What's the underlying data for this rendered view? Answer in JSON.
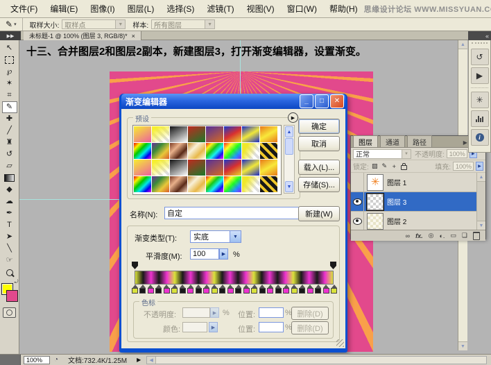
{
  "menu": {
    "items": [
      "文件(F)",
      "编辑(E)",
      "图像(I)",
      "图层(L)",
      "选择(S)",
      "滤镜(T)",
      "视图(V)",
      "窗口(W)",
      "帮助(H)"
    ],
    "brand": "思缘设计论坛 WWW.MISSYUAN.COM"
  },
  "options_bar": {
    "sample_size_label": "取样大小:",
    "sample_size_value": "取样点",
    "sample_label": "样本:",
    "sample_value": "所有图层"
  },
  "doc_tab": {
    "title": "未标题-1 @ 100% (图层 3, RGB/8)*",
    "close": "×"
  },
  "instruction": "十三、合并图层2和图层2副本，新建图层3，打开渐变编辑器，设置渐变。",
  "toolbar": {
    "tools": [
      {
        "name": "move-tool",
        "glyph": "↖"
      },
      {
        "name": "marquee-tool",
        "cls": "icon-dashed"
      },
      {
        "name": "lasso-tool",
        "glyph": "℘"
      },
      {
        "name": "magic-wand-tool",
        "glyph": "✶"
      },
      {
        "name": "crop-tool",
        "glyph": "⌗"
      },
      {
        "name": "eyedropper-tool",
        "glyph": "✎",
        "selected": true
      },
      {
        "name": "healing-brush-tool",
        "glyph": "✚"
      },
      {
        "name": "brush-tool",
        "glyph": "╱"
      },
      {
        "name": "clone-stamp-tool",
        "glyph": "♜"
      },
      {
        "name": "history-brush-tool",
        "glyph": "↺"
      },
      {
        "name": "eraser-tool",
        "glyph": "▱"
      },
      {
        "name": "gradient-tool",
        "cls": "icon-grad"
      },
      {
        "name": "blur-tool",
        "glyph": "◆"
      },
      {
        "name": "dodge-tool",
        "glyph": "☁"
      },
      {
        "name": "pen-tool",
        "glyph": "✒"
      },
      {
        "name": "type-tool",
        "glyph": "T"
      },
      {
        "name": "path-selection-tool",
        "glyph": "➤"
      },
      {
        "name": "line-tool",
        "glyph": "╲"
      },
      {
        "name": "hand-tool",
        "glyph": "☞"
      },
      {
        "name": "zoom-tool",
        "cls": "icon-zoom"
      }
    ],
    "foreground_color": "#ffff00",
    "background_color": "#e2498c"
  },
  "canvas_colors": {
    "background": "#e2498c",
    "rays": "#f9a04a",
    "guide": "#a8e4de"
  },
  "dialog": {
    "title": "渐变编辑器",
    "presets_label": "预设",
    "ok": "确定",
    "cancel": "取消",
    "load": "载入(L)...",
    "save": "存储(S)...",
    "name_label": "名称(N):",
    "name_value": "自定",
    "new_button": "新建(W)",
    "type_label": "渐变类型(T):",
    "type_value": "实底",
    "smooth_label": "平滑度(M):",
    "smooth_value": "100",
    "percent": "%",
    "stops_label": "色标",
    "opacity_label": "不透明度:",
    "color_label": "颜色:",
    "location_label": "位置:",
    "location2_label": "位置:",
    "delete_label": "删除(D)",
    "presets": [
      "linear-gradient(150deg,#f6ef2f,#ec5f9f)",
      "linear-gradient(150deg,#f6ef2f 15%,rgba(246,239,47,0) 85%),repeating-linear-gradient(45deg,#ddd 0 4px,#fff 4px 8px)",
      "linear-gradient(150deg,#141414,#fdfdfd)",
      "linear-gradient(150deg,#c02a20,#1a7a2a)",
      "linear-gradient(150deg,#53309c,#d86a20)",
      "linear-gradient(150deg,#1a3ac8,#d83030,#e8d82a)",
      "linear-gradient(150deg,#1a2ac8,#f0e83a,#1a2ac8)",
      "linear-gradient(150deg,#e87a1a,#f8e83a,#e87a1a)",
      "linear-gradient(135deg,#f00000,#f8f000,#00c800,#00e8e8,#0000f0,#e800e8)",
      "linear-gradient(135deg,#6a2a9c,#3a8a3a,#e8c83a,#d85a2a)",
      "linear-gradient(135deg,#7a3a22,#e8b08a,#5a2a18,#f8d8c0)",
      "linear-gradient(135deg,#c8882a,#f8f0d8,#e8b84a,#fffbe8)",
      "linear-gradient(135deg,#f01818,#f8f018,#18c818,#18f0f0,#1818f0,#f018f0)",
      "linear-gradient(135deg,rgba(255,0,0,.85),rgba(255,255,0,.85),rgba(0,255,0,.85),rgba(0,128,255,.85),rgba(128,0,255,.85)),repeating-linear-gradient(45deg,#ddd 0 4px,#fff 4px 8px)",
      "linear-gradient(120deg,#f0e82a 25%,rgba(240,232,42,0) 75%),repeating-linear-gradient(45deg,#ddd 0 4px,#fff 4px 8px)",
      "repeating-linear-gradient(45deg,#181818 0 5px,#f0c82a 5px 9px)"
    ],
    "gradient_stops": [
      "#d9e23b",
      "#191919",
      "#ee33d0",
      "#191919",
      "#ee33d0",
      "#d9e23b",
      "#191919",
      "#ee33d0",
      "#191919",
      "#ee33d0",
      "#d9e23b",
      "#191919",
      "#ee33d0",
      "#191919",
      "#ee33d0",
      "#d9e23b",
      "#191919",
      "#ee33d0",
      "#191919",
      "#ee33d0",
      "#d9e23b",
      "#191919",
      "#ee33d0",
      "#191919",
      "#ee33d0",
      "#d9e23b"
    ]
  },
  "layers_panel": {
    "tabs": [
      "图层",
      "通道",
      "路径"
    ],
    "blend_mode": "正常",
    "opacity_label": "不透明度:",
    "opacity_value": "100%",
    "lock_label": "锁定:",
    "fill_label": "填充:",
    "fill_value": "100%",
    "layers": [
      {
        "name": "图层 1",
        "eye": false,
        "selected": false,
        "thumb": "star"
      },
      {
        "name": "图层 3",
        "eye": true,
        "selected": true,
        "thumb": "checker"
      },
      {
        "name": "图层 2",
        "eye": true,
        "selected": false,
        "thumb": "pale"
      }
    ]
  },
  "status_bar": {
    "zoom": "100%",
    "doc_info": "文档:732.4K/1.25M"
  }
}
